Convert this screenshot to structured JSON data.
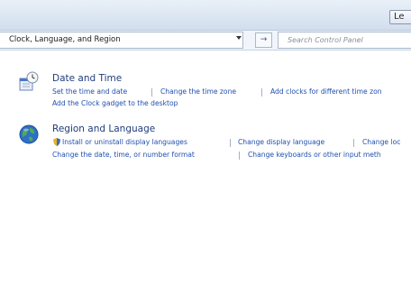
{
  "window": {
    "title_button_label": "Le"
  },
  "navbar": {
    "address": "Clock, Language, and Region",
    "search_placeholder": "Search Control Panel",
    "refresh_glyph": "→"
  },
  "categories": [
    {
      "title": "Date and Time",
      "icon": "clock-calendar-icon",
      "links_row1": [
        "Set the time and date",
        "Change the time zone",
        "Add clocks for different time zon"
      ],
      "links_row2": [
        "Add the Clock gadget to the desktop"
      ]
    },
    {
      "title": "Region and Language",
      "icon": "globe-icon",
      "links_row1": [
        "Install or uninstall display languages",
        "Change display language",
        "Change loc"
      ],
      "links_row2": [
        "Change the date, time, or number format",
        "Change keyboards or other input meth"
      ]
    }
  ],
  "colors": {
    "link": "#1f4fb0",
    "heading": "#1f3d7a",
    "titlebar": "#d2deee"
  }
}
